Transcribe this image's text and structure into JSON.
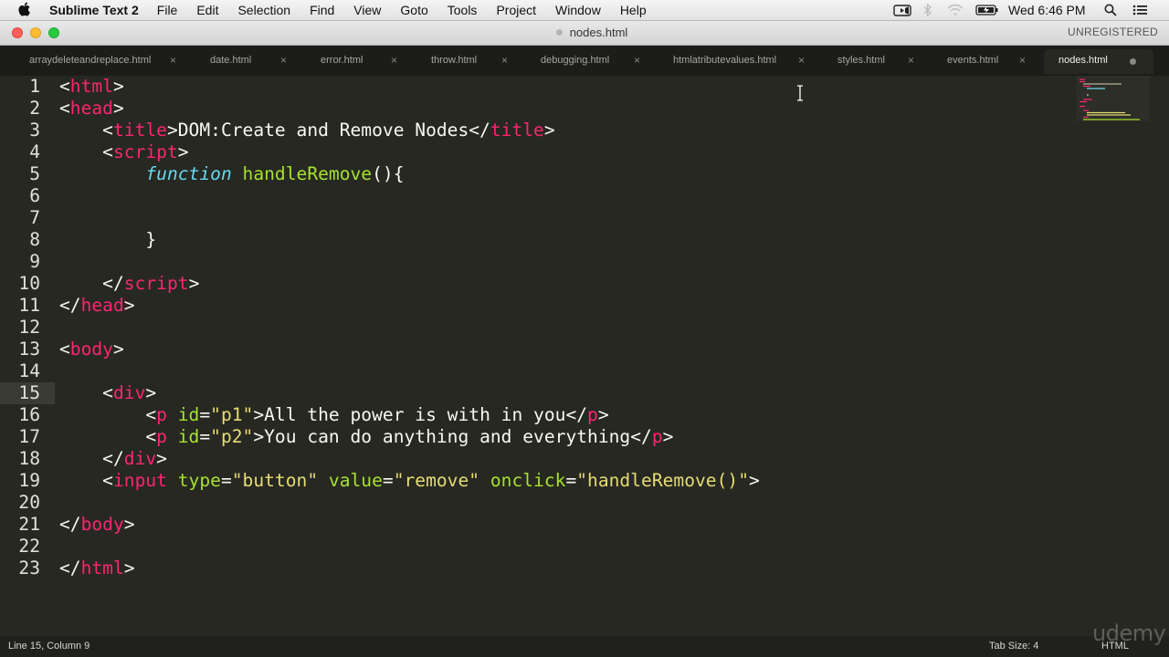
{
  "menubar": {
    "app_name": "Sublime Text 2",
    "items": [
      "File",
      "Edit",
      "Selection",
      "Find",
      "View",
      "Goto",
      "Tools",
      "Project",
      "Window",
      "Help"
    ],
    "clock": "Wed 6:46 PM"
  },
  "window": {
    "title": "nodes.html",
    "license": "UNREGISTERED"
  },
  "tabs": [
    {
      "label": "arraydeleteandreplace.html"
    },
    {
      "label": "date.html"
    },
    {
      "label": "error.html"
    },
    {
      "label": "throw.html"
    },
    {
      "label": "debugging.html"
    },
    {
      "label": "htmlatributevalues.html"
    },
    {
      "label": "styles.html"
    },
    {
      "label": "events.html"
    },
    {
      "label": "nodes.html",
      "active": true,
      "dirty": true
    }
  ],
  "editor": {
    "current_line": 15,
    "line_numbers": [
      "1",
      "2",
      "3",
      "4",
      "5",
      "6",
      "7",
      "8",
      "9",
      "10",
      "11",
      "12",
      "13",
      "14",
      "15",
      "16",
      "17",
      "18",
      "19",
      "20",
      "21",
      "22",
      "23"
    ],
    "lines": [
      [
        [
          "<",
          ""
        ],
        [
          "html",
          "tg"
        ],
        [
          ">",
          ""
        ]
      ],
      [
        [
          "<",
          ""
        ],
        [
          "head",
          "tg"
        ],
        [
          ">",
          ""
        ]
      ],
      [
        [
          "    <",
          ""
        ],
        [
          "title",
          "tg"
        ],
        [
          ">DOM:Create and Remove Nodes</",
          ""
        ],
        [
          "title",
          "tg"
        ],
        [
          ">",
          ""
        ]
      ],
      [
        [
          "    <",
          ""
        ],
        [
          "script",
          "tg"
        ],
        [
          ">",
          ""
        ]
      ],
      [
        [
          "        ",
          ""
        ],
        [
          "function",
          "kw"
        ],
        [
          " ",
          ""
        ],
        [
          "handleRemove",
          "fn"
        ],
        [
          "(){",
          ""
        ]
      ],
      [],
      [],
      [
        [
          "        }",
          ""
        ]
      ],
      [],
      [
        [
          "    </",
          ""
        ],
        [
          "script",
          "tg"
        ],
        [
          ">",
          ""
        ]
      ],
      [
        [
          "</",
          ""
        ],
        [
          "head",
          "tg"
        ],
        [
          ">",
          ""
        ]
      ],
      [],
      [
        [
          "<",
          ""
        ],
        [
          "body",
          "tg"
        ],
        [
          ">",
          ""
        ]
      ],
      [],
      [
        [
          "    <",
          ""
        ],
        [
          "div",
          "tg"
        ],
        [
          ">",
          ""
        ]
      ],
      [
        [
          "        <",
          ""
        ],
        [
          "p",
          "tg"
        ],
        [
          " ",
          ""
        ],
        [
          "id",
          "at"
        ],
        [
          "=",
          ""
        ],
        [
          "\"p1\"",
          "st2"
        ],
        [
          ">All the power is with in you</",
          ""
        ],
        [
          "p",
          "tg"
        ],
        [
          ">",
          ""
        ]
      ],
      [
        [
          "        <",
          ""
        ],
        [
          "p",
          "tg"
        ],
        [
          " ",
          ""
        ],
        [
          "id",
          "at"
        ],
        [
          "=",
          ""
        ],
        [
          "\"p2\"",
          "st2"
        ],
        [
          ">You can do anything and everything</",
          ""
        ],
        [
          "p",
          "tg"
        ],
        [
          ">",
          ""
        ]
      ],
      [
        [
          "    </",
          ""
        ],
        [
          "div",
          "tg"
        ],
        [
          ">",
          ""
        ]
      ],
      [
        [
          "    <",
          ""
        ],
        [
          "input",
          "tg"
        ],
        [
          " ",
          ""
        ],
        [
          "type",
          "at"
        ],
        [
          "=",
          ""
        ],
        [
          "\"button\"",
          "st2"
        ],
        [
          " ",
          ""
        ],
        [
          "value",
          "at"
        ],
        [
          "=",
          ""
        ],
        [
          "\"remove\"",
          "st2"
        ],
        [
          " ",
          ""
        ],
        [
          "onclick",
          "at"
        ],
        [
          "=",
          ""
        ],
        [
          "\"handleRemove()\"",
          "st2"
        ],
        [
          ">",
          ""
        ]
      ],
      [],
      [
        [
          "</",
          ""
        ],
        [
          "body",
          "tg"
        ],
        [
          ">",
          ""
        ]
      ],
      [],
      [
        [
          "</",
          ""
        ],
        [
          "html",
          "tg"
        ],
        [
          ">",
          ""
        ]
      ]
    ]
  },
  "statusbar": {
    "position": "Line 15, Column 9",
    "tab_size": "Tab Size: 4",
    "syntax": "HTML"
  },
  "watermark": "udemy",
  "icons": {
    "apple": "apple-logo-icon",
    "camera": "facetime-camera-icon",
    "bluetooth": "bluetooth-icon",
    "wifi": "wifi-icon",
    "battery": "battery-icon",
    "search": "spotlight-search-icon",
    "list": "notification-center-icon"
  },
  "colors": {
    "background": "#272822",
    "tag": "#f92672",
    "attribute": "#a6e22e",
    "string": "#e6db74",
    "keyword": "#66d9ef"
  }
}
